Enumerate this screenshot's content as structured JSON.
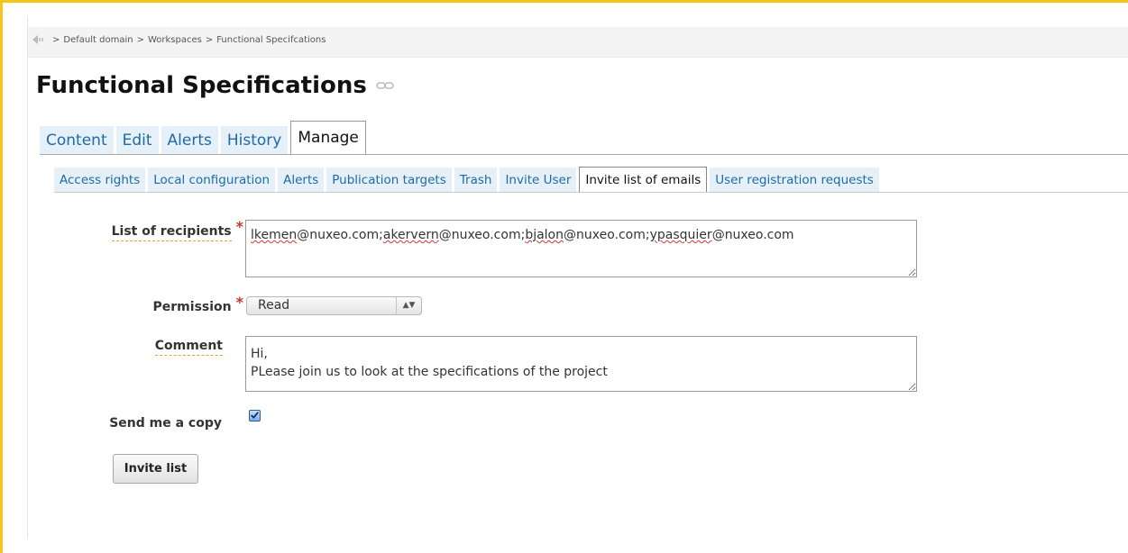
{
  "breadcrumb": {
    "separator": ">",
    "items": [
      "Default domain",
      "Workspaces",
      "Functional Specifcations"
    ]
  },
  "page": {
    "title": "Functional Specifications"
  },
  "tabs": [
    {
      "label": "Content"
    },
    {
      "label": "Edit"
    },
    {
      "label": "Alerts"
    },
    {
      "label": "History"
    },
    {
      "label": "Manage",
      "active": true
    }
  ],
  "subtabs": [
    {
      "label": "Access rights"
    },
    {
      "label": "Local configuration"
    },
    {
      "label": "Alerts"
    },
    {
      "label": "Publication targets"
    },
    {
      "label": "Trash"
    },
    {
      "label": "Invite User"
    },
    {
      "label": "Invite list of emails",
      "active": true
    },
    {
      "label": "User registration requests"
    }
  ],
  "form": {
    "recipients_label": "List of recipients",
    "required_mark": "*",
    "recipients": [
      {
        "name": "lkemen",
        "domain": "@nuxeo.com"
      },
      {
        "name": "akervern",
        "domain": "@nuxeo.com"
      },
      {
        "name": "bjalon",
        "domain": "@nuxeo.com"
      },
      {
        "name": "ypasquier",
        "domain": "@nuxeo.com"
      }
    ],
    "recipients_delimiter": ";",
    "permission_label": "Permission",
    "permission_value": "Read",
    "comment_label": "Comment",
    "comment_line1": "Hi,",
    "comment_line2": "PLease join us to look at the specifications of the project",
    "send_copy_label": "Send me a copy",
    "send_copy_checked": true,
    "submit_label": "Invite list"
  },
  "colors": {
    "frame": "#f5c518",
    "tab_link": "#1f6aa5",
    "tab_bg": "#e6f0f8",
    "required": "#c0392b"
  }
}
